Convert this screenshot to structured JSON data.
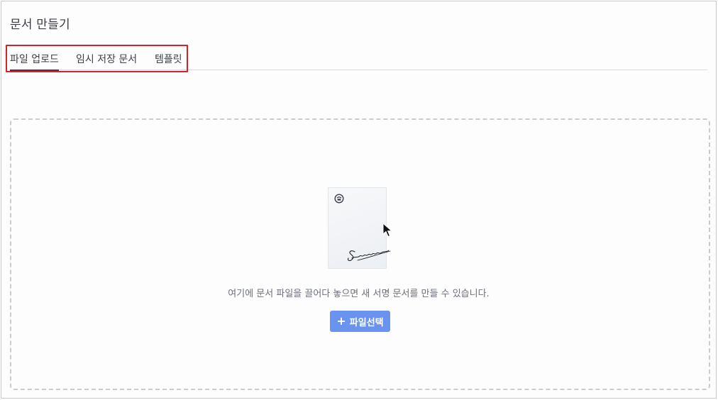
{
  "page": {
    "title": "문서 만들기"
  },
  "tabs": [
    {
      "label": "파일 업로드",
      "active": true
    },
    {
      "label": "임시 저장 문서",
      "active": false
    },
    {
      "label": "템플릿",
      "active": false
    }
  ],
  "dropzone": {
    "hint": "여기에 문서 파일을 끌어다 놓으면 새 서명 문서를 만들 수 있습니다.",
    "select_button_label": "파일선택",
    "select_button_icon": "plus-icon",
    "illustration": {
      "badge_icon": "seal-icon",
      "cursor_icon": "mouse-pointer-icon",
      "signature_text": "Signature"
    }
  },
  "colors": {
    "tab_highlight_border": "#d4232a",
    "primary_button": "#6a93ef",
    "dropzone_border": "#c9ccd2"
  }
}
